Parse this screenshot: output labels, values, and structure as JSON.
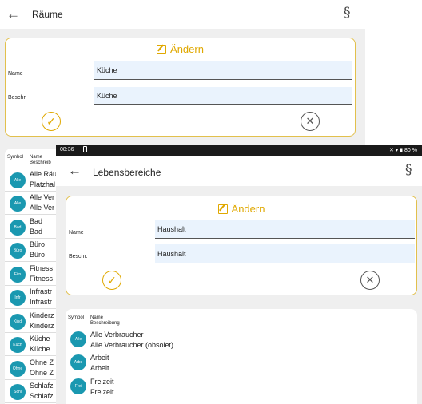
{
  "screen1": {
    "title": "Räume",
    "section_symbol": "§",
    "edit_card": {
      "heading": "Ändern",
      "name_label": "Name",
      "name_value": "Küche",
      "desc_label": "Beschr.",
      "desc_value": "Küche"
    },
    "list": {
      "col_symbol": "Symbol",
      "col_name": "Name",
      "col_desc": "Beschreib",
      "rows": [
        {
          "abbr": "Alle",
          "name": "Alle Räu",
          "desc": "Platzhal"
        },
        {
          "abbr": "Alle",
          "name": "Alle Ver",
          "desc": "Alle Ver"
        },
        {
          "abbr": "Bad",
          "name": "Bad",
          "desc": "Bad"
        },
        {
          "abbr": "Büro",
          "name": "Büro",
          "desc": "Büro"
        },
        {
          "abbr": "Fitn",
          "name": "Fitness",
          "desc": "Fitness"
        },
        {
          "abbr": "Infr",
          "name": "Infrastr",
          "desc": "Infrastr"
        },
        {
          "abbr": "Kind",
          "name": "Kinderz",
          "desc": "Kinderz"
        },
        {
          "abbr": "Küch",
          "name": "Küche",
          "desc": "Küche"
        },
        {
          "abbr": "Ohne",
          "name": "Ohne Z",
          "desc": "Ohne Z"
        },
        {
          "abbr": "Schl",
          "name": "Schlafzi",
          "desc": "Schlafzi"
        }
      ]
    }
  },
  "screen2": {
    "status": {
      "time": "08:36",
      "right": "✕ ▾ ▮ 80 %"
    },
    "title": "Lebensbereiche",
    "section_symbol": "§",
    "edit_card": {
      "heading": "Ändern",
      "name_label": "Name",
      "name_value": "Haushalt",
      "desc_label": "Beschr.",
      "desc_value": "Haushalt"
    },
    "list": {
      "col_symbol": "Symbol",
      "col_name": "Name",
      "col_desc": "Beschreibung",
      "rows": [
        {
          "abbr": "Alle",
          "name": "Alle Verbraucher",
          "desc": "Alle Verbraucher (obsolet)"
        },
        {
          "abbr": "Arbe",
          "name": "Arbeit",
          "desc": "Arbeit"
        },
        {
          "abbr": "Frei",
          "name": "Freizeit",
          "desc": "Freizeit"
        }
      ]
    }
  },
  "colors": {
    "accent": "#e0a800",
    "avatar": "#1a98b0",
    "input_bg": "#eaf3fd"
  },
  "icons": [
    "back-arrow-icon",
    "section-icon",
    "edit-icon",
    "check-icon",
    "close-icon"
  ]
}
